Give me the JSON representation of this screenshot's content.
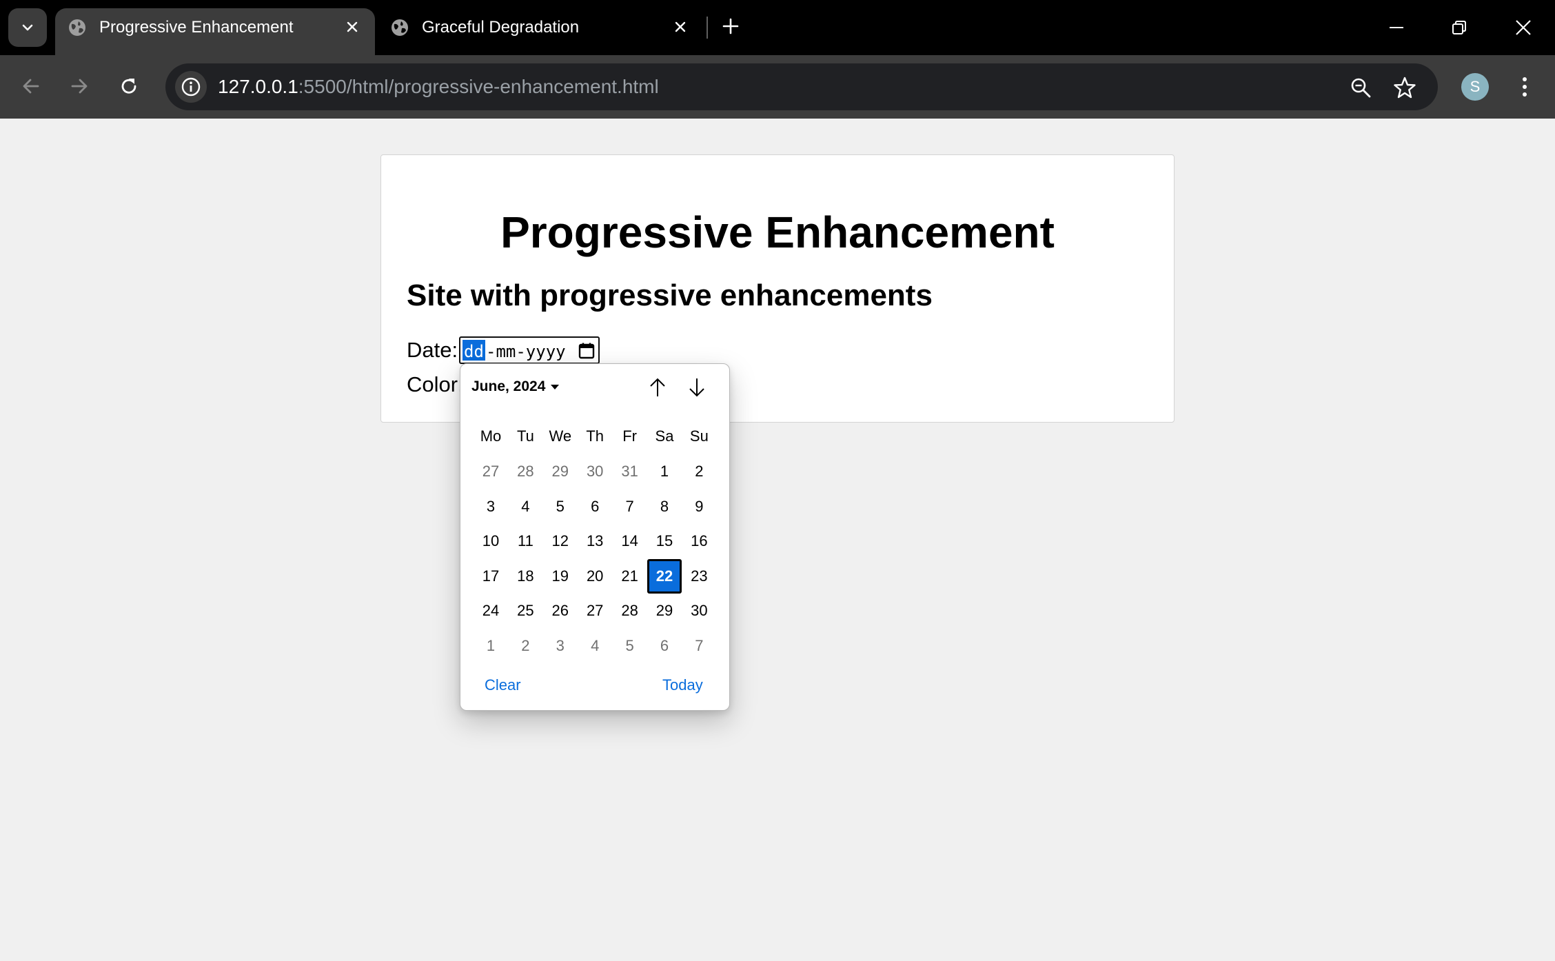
{
  "browser": {
    "tabs": [
      {
        "title": "Progressive Enhancement",
        "active": true
      },
      {
        "title": "Graceful Degradation",
        "active": false
      }
    ],
    "url_host": "127.0.0.1",
    "url_path": ":5500/html/progressive-enhancement.html",
    "profile_initial": "S"
  },
  "page": {
    "title": "Progressive Enhancement",
    "subtitle": "Site with progressive enhancements",
    "date_label": "Date:",
    "color_label": "Color:",
    "date_input": {
      "active_segment": "dd",
      "rest": "-mm-yyyy"
    }
  },
  "datepicker": {
    "month_label": "June, 2024",
    "weekdays": [
      "Mo",
      "Tu",
      "We",
      "Th",
      "Fr",
      "Sa",
      "Su"
    ],
    "weeks": [
      [
        {
          "d": "27",
          "m": true
        },
        {
          "d": "28",
          "m": true
        },
        {
          "d": "29",
          "m": true
        },
        {
          "d": "30",
          "m": true
        },
        {
          "d": "31",
          "m": true
        },
        {
          "d": "1"
        },
        {
          "d": "2"
        }
      ],
      [
        {
          "d": "3"
        },
        {
          "d": "4"
        },
        {
          "d": "5"
        },
        {
          "d": "6"
        },
        {
          "d": "7"
        },
        {
          "d": "8"
        },
        {
          "d": "9"
        }
      ],
      [
        {
          "d": "10"
        },
        {
          "d": "11"
        },
        {
          "d": "12"
        },
        {
          "d": "13"
        },
        {
          "d": "14"
        },
        {
          "d": "15"
        },
        {
          "d": "16"
        }
      ],
      [
        {
          "d": "17"
        },
        {
          "d": "18"
        },
        {
          "d": "19"
        },
        {
          "d": "20"
        },
        {
          "d": "21"
        },
        {
          "d": "22",
          "s": true
        },
        {
          "d": "23"
        }
      ],
      [
        {
          "d": "24"
        },
        {
          "d": "25"
        },
        {
          "d": "26"
        },
        {
          "d": "27"
        },
        {
          "d": "28"
        },
        {
          "d": "29"
        },
        {
          "d": "30"
        }
      ],
      [
        {
          "d": "1",
          "m": true
        },
        {
          "d": "2",
          "m": true
        },
        {
          "d": "3",
          "m": true
        },
        {
          "d": "4",
          "m": true
        },
        {
          "d": "5",
          "m": true
        },
        {
          "d": "6",
          "m": true
        },
        {
          "d": "7",
          "m": true
        }
      ]
    ],
    "clear_label": "Clear",
    "today_label": "Today"
  },
  "colors": {
    "accent": "#0a6ddc",
    "chrome_dark": "#000000",
    "toolbar": "#3c3c3c",
    "page_bg": "#f0f0f0"
  }
}
